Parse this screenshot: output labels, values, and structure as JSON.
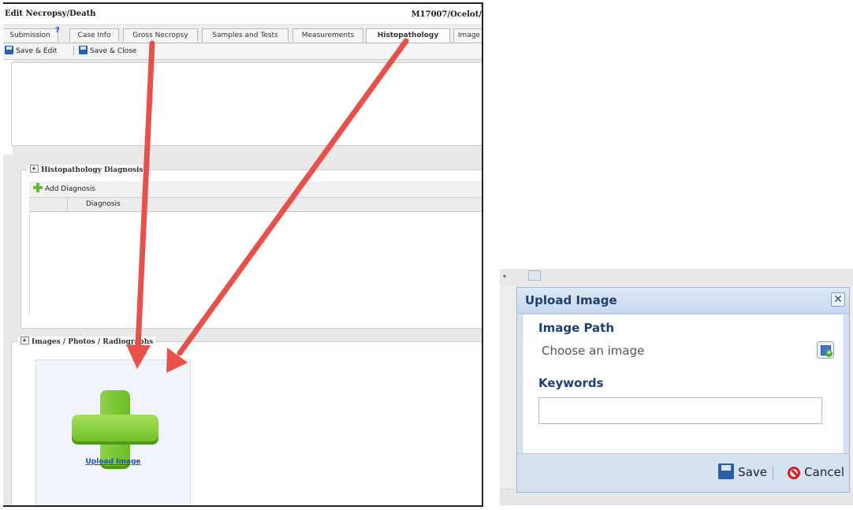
{
  "left": {
    "window_title": "Edit Necropsy/Death",
    "record_id": "M17007/Ocelot/",
    "help_mark": "?",
    "tabs": [
      "Submission",
      "Case Info",
      "Gross Necropsy",
      "Samples and Tests",
      "Measurements",
      "Histopathology",
      "Image"
    ],
    "active_tab": "Histopathology",
    "actions": {
      "save_edit": "Save & Edit",
      "save_close": "Save & Close"
    },
    "diagnosis": {
      "legend": "Histopathology Diagnosis",
      "add_label": "Add Diagnosis",
      "column_header": "Diagnosis"
    },
    "images": {
      "legend": "Images / Photos / Radiographs",
      "upload_link": "Upload Image"
    }
  },
  "dialog": {
    "title": "Upload Image",
    "close_glyph": "✕",
    "image_path_label": "Image Path",
    "image_path_value": "Choose an image",
    "keywords_label": "Keywords",
    "keywords_value": "",
    "save_label": "Save",
    "cancel_label": "Cancel"
  },
  "colors": {
    "arrow": "#e8504a",
    "dialog_title": "#1d3f72",
    "plus_green": "#6cbc22",
    "link_blue": "#1b4fc4"
  }
}
